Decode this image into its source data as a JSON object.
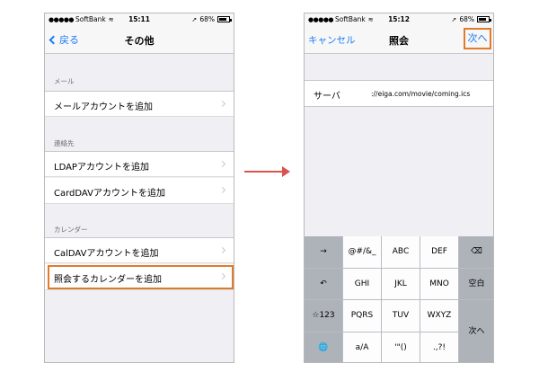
{
  "left": {
    "status": {
      "carrier": "SoftBank",
      "time": "15:11",
      "battery": "68%",
      "battery_level": 0.68
    },
    "nav": {
      "back_label": "戻る",
      "title": "その他"
    },
    "sections": [
      {
        "header": "メール",
        "items": [
          "メールアカウントを追加"
        ]
      },
      {
        "header": "連絡先",
        "items": [
          "LDAPアカウントを追加",
          "CardDAVアカウントを追加"
        ]
      },
      {
        "header": "カレンダー",
        "items": [
          "CalDAVアカウントを追加",
          "照会するカレンダーを追加"
        ]
      }
    ]
  },
  "right": {
    "status": {
      "carrier": "SoftBank",
      "time": "15:12",
      "battery": "68%",
      "battery_level": 0.68
    },
    "nav": {
      "cancel_label": "キャンセル",
      "title": "照会",
      "next_label": "次へ"
    },
    "server": {
      "label": "サーバ",
      "value": "://eiga.com/movie/coming.ics"
    },
    "keyboard": {
      "row1": [
        "→",
        "@#/&_",
        "ABC",
        "DEF",
        "⌫"
      ],
      "row2": [
        "↶",
        "GHI",
        "JKL",
        "MNO",
        "空白"
      ],
      "row3": [
        "☆123",
        "PQRS",
        "TUV",
        "WXYZ"
      ],
      "row4": [
        "🌐",
        "a/A",
        "'\"()",
        ".,?!"
      ],
      "return_label": "次へ"
    }
  },
  "colors": {
    "accent": "#1a7cf5",
    "highlight": "#e07b2a",
    "arrow": "#d9534f"
  }
}
